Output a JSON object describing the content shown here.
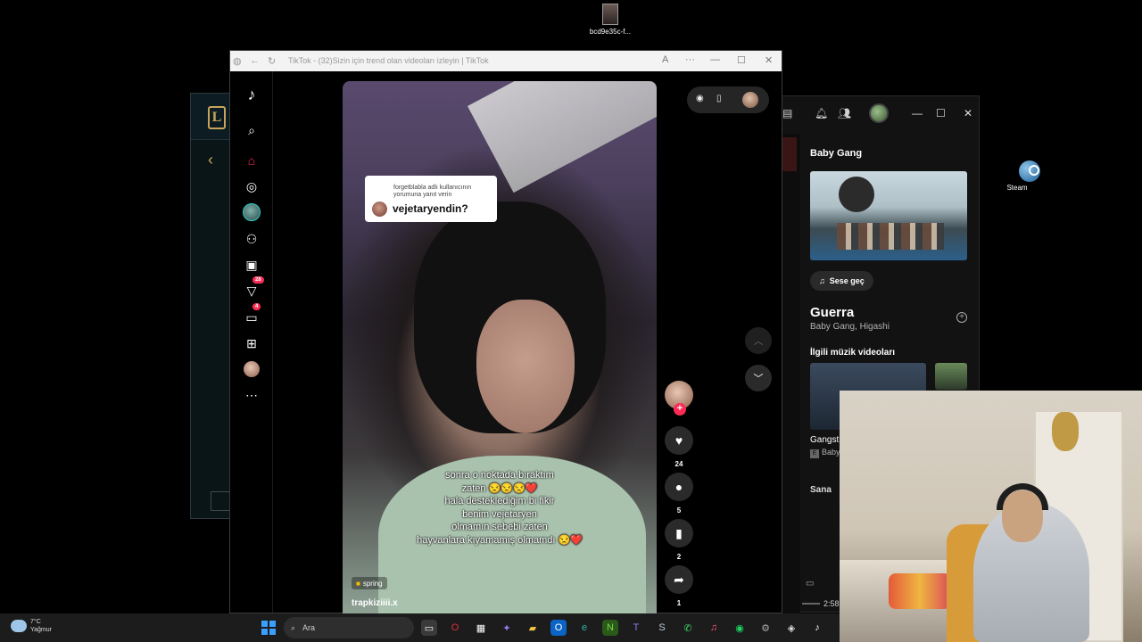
{
  "desktop": {
    "file_label": "bcd9e35c-f...",
    "steam_label": "Steam"
  },
  "browser": {
    "title": "TikTok - (32)Sizin için trend olan videoları izleyin | TikTok"
  },
  "sidebar": {
    "badge_activity": "28",
    "badge_messages": "4"
  },
  "video": {
    "reply_small": "forgetblabla adlı kullanıcının yorumuna yanıt verin",
    "reply_big": "vejetaryendin?",
    "caption_lines": [
      "sonra o noktada bıraktım",
      "zaten 😒😒😒❤️",
      "hala desteklediğim bi fikir",
      "benim vejetaryen",
      "olmamın sebebi zaten",
      "hayvanlara kıyamamış olmamdı 😒❤️"
    ],
    "music_label": "spring",
    "author": "trapkiziiii.x"
  },
  "actions": {
    "likes": "24",
    "comments": "5",
    "saves": "2",
    "shares": "1"
  },
  "spotify": {
    "artist_header": "Baby Gang",
    "switch_audio": "Sese geç",
    "song_title": "Guerra",
    "song_artists": "Baby Gang, Higashi",
    "related_header": "İlgili müzik videoları",
    "related_title": "Gangst",
    "related_sub": "Baby",
    "next_label": "Sana",
    "time": "2:58"
  },
  "taskbar": {
    "temp": "7°C",
    "weather": "Yağmur",
    "search_placeholder": "Ara"
  },
  "colors": {
    "tiktok_red": "#fe2c55",
    "win_blue": "#3aa0ff"
  }
}
